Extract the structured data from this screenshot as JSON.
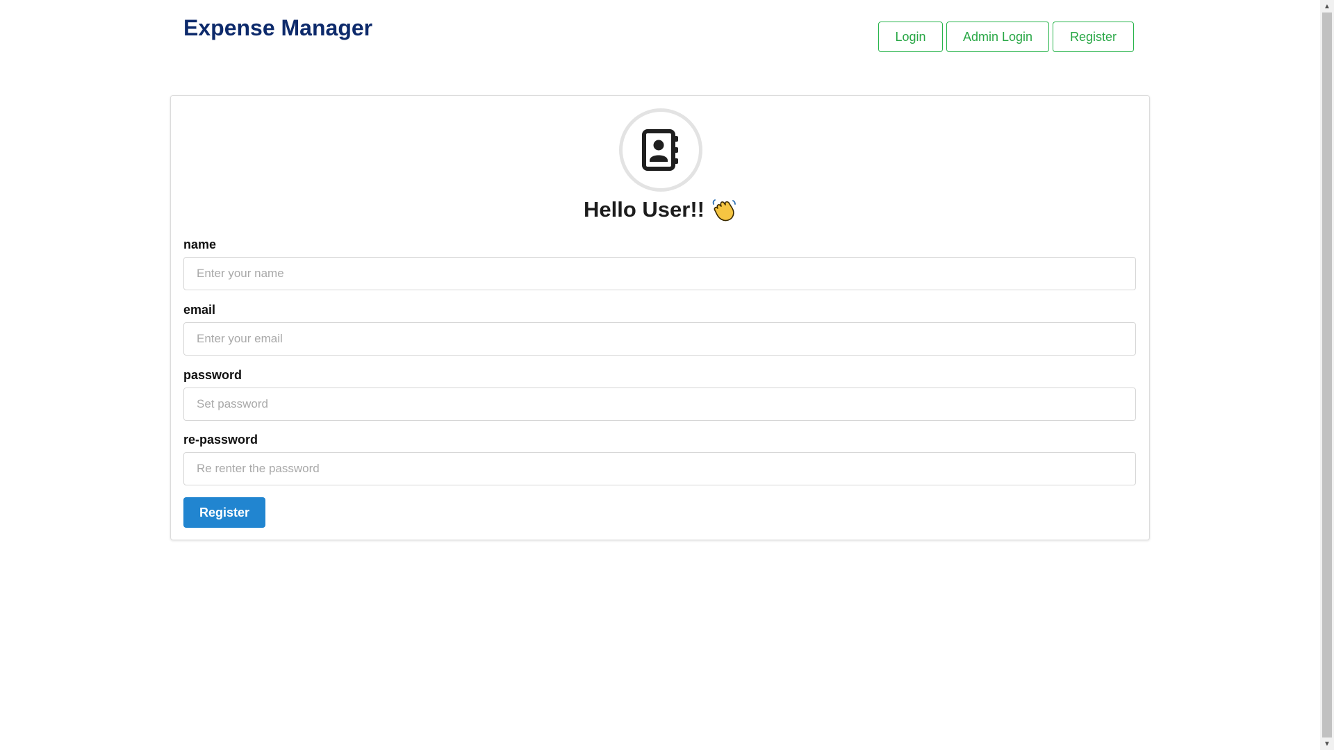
{
  "header": {
    "title": "Expense Manager",
    "nav": {
      "login_label": "Login",
      "admin_login_label": "Admin Login",
      "register_label": "Register"
    }
  },
  "card": {
    "avatar_icon": "contact-book-icon",
    "greeting": "Hello User!!",
    "greeting_emoji": "👋",
    "fields": {
      "name": {
        "label": "name",
        "placeholder": "Enter your name",
        "value": ""
      },
      "email": {
        "label": "email",
        "placeholder": "Enter your email",
        "value": ""
      },
      "password": {
        "label": "password",
        "placeholder": "Set password",
        "value": ""
      },
      "repassword": {
        "label": "re-password",
        "placeholder": "Re renter the password",
        "value": ""
      }
    },
    "submit_label": "Register"
  },
  "colors": {
    "title": "#0d2a6b",
    "nav_accent": "#28a745",
    "primary_button": "#2185d0",
    "wave_emoji": "#f5c542"
  },
  "scrollbar": {
    "up_icon": "scroll-up-arrow-icon",
    "down_icon": "scroll-down-arrow-icon"
  }
}
